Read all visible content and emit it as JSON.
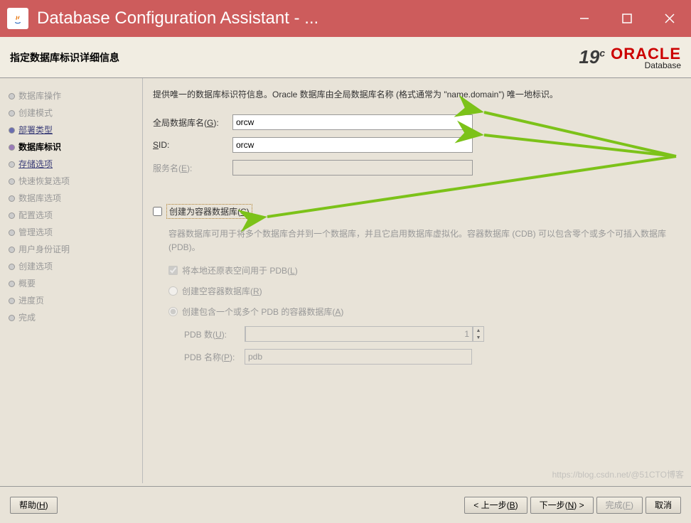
{
  "window": {
    "title": "Database Configuration Assistant - ..."
  },
  "header": {
    "page_title": "指定数据库标识详细信息",
    "version": "19",
    "version_sup": "c",
    "brand": "ORACLE",
    "brand_sub": "Database"
  },
  "sidebar": {
    "steps": [
      {
        "label": "数据库操作",
        "state": "past"
      },
      {
        "label": "创建模式",
        "state": "past"
      },
      {
        "label": "部署类型",
        "state": "done"
      },
      {
        "label": "数据库标识",
        "state": "current"
      },
      {
        "label": "存储选项",
        "state": "link"
      },
      {
        "label": "快速恢复选项",
        "state": "future"
      },
      {
        "label": "数据库选项",
        "state": "future"
      },
      {
        "label": "配置选项",
        "state": "future"
      },
      {
        "label": "管理选项",
        "state": "future"
      },
      {
        "label": "用户身份证明",
        "state": "future"
      },
      {
        "label": "创建选项",
        "state": "future"
      },
      {
        "label": "概要",
        "state": "future"
      },
      {
        "label": "进度页",
        "state": "future"
      },
      {
        "label": "完成",
        "state": "future"
      }
    ]
  },
  "main": {
    "description": "提供唯一的数据库标识符信息。Oracle 数据库由全局数据库名称 (格式通常为 \"name.domain\") 唯一地标识。",
    "global_db_label_pre": "全局数据库名(",
    "global_db_key": "G",
    "global_db_label_post": "):",
    "global_db_value": "orcw",
    "sid_label_pre": "",
    "sid_key": "S",
    "sid_label_post": "ID:",
    "sid_value": "orcw",
    "service_label_pre": "服务名(",
    "service_key": "E",
    "service_label_post": "):",
    "service_value": "",
    "container_cb_pre": "创建为容器数据库(",
    "container_cb_key": "C",
    "container_cb_post": ")",
    "container_checked": false,
    "sub_description": "容器数据库可用于将多个数据库合并到一个数据库，并且它启用数据库虚拟化。容器数据库 (CDB) 可以包含零个或多个可插入数据库 (PDB)。",
    "local_undo_pre": "将本地还原表空间用于 PDB(",
    "local_undo_key": "L",
    "local_undo_post": ")",
    "local_undo_checked": true,
    "empty_cdb_pre": "创建空容器数据库(",
    "empty_cdb_key": "R",
    "empty_cdb_post": ")",
    "with_pdb_pre": "创建包含一个或多个 PDB 的容器数据库(",
    "with_pdb_key": "A",
    "with_pdb_post": ")",
    "pdb_count_pre": "PDB 数(",
    "pdb_count_key": "U",
    "pdb_count_post": "):",
    "pdb_count_value": "1",
    "pdb_name_pre": "PDB 名称(",
    "pdb_name_key": "P",
    "pdb_name_post": "):",
    "pdb_name_value": "pdb"
  },
  "footer": {
    "help_pre": "帮助(",
    "help_key": "H",
    "help_post": ")",
    "back_pre": "< 上一步(",
    "back_key": "B",
    "back_post": ")",
    "next_pre": "下一步(",
    "next_key": "N",
    "next_post": ") >",
    "finish_pre": "完成(",
    "finish_key": "F",
    "finish_post": ")",
    "cancel": "取消"
  },
  "watermark": "https://blog.csdn.net/@51CTO博客"
}
